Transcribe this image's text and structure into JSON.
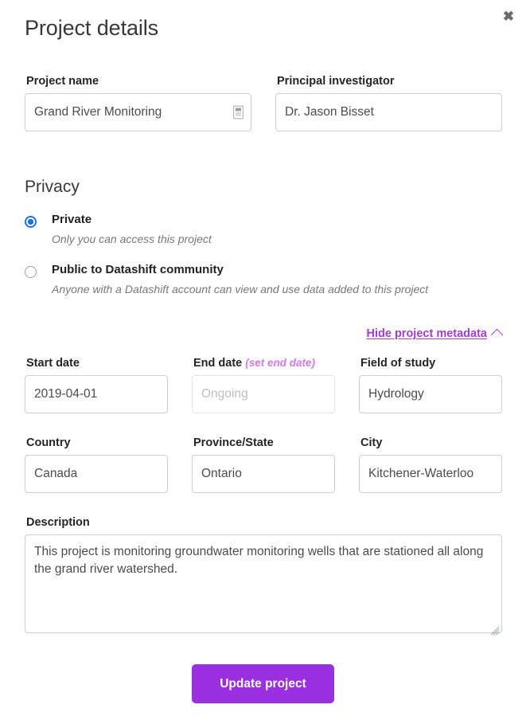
{
  "dialog": {
    "title": "Project details",
    "close_label": "✖"
  },
  "top_fields": {
    "project_name": {
      "label": "Project name",
      "value": "Grand River Monitoring",
      "placeholder": "Project name",
      "icon": "document-icon"
    },
    "principal_investigator": {
      "label": "Principal investigator",
      "value": "Dr. Jason Bisset",
      "placeholder": "Principal investigator"
    }
  },
  "privacy": {
    "heading": "Privacy",
    "options": [
      {
        "title": "Private",
        "description": "Only you can access this project",
        "selected": true
      },
      {
        "title": "Public to Datashift community",
        "description": "Anyone with a Datashift account can view and use data added to this project",
        "selected": false
      }
    ]
  },
  "metadata_toggle": {
    "label": "Hide project metadata",
    "icon": "chevron-up-icon",
    "color": "#a23cd6"
  },
  "metadata": {
    "start_date": {
      "label": "Start date",
      "value": "2019-04-01",
      "placeholder": "Start date"
    },
    "end_date": {
      "label": "End date",
      "note": "(set end date)",
      "value": "",
      "placeholder": "Ongoing"
    },
    "field_of_study": {
      "label": "Field of study",
      "value": "Hydrology",
      "placeholder": "Field of study"
    },
    "country": {
      "label": "Country",
      "value": "Canada",
      "placeholder": "Country"
    },
    "province_state": {
      "label": "Province/State",
      "value": "Ontario",
      "placeholder": "Province/State"
    },
    "city": {
      "label": "City",
      "value": "Kitchener-Waterloo",
      "placeholder": "City"
    }
  },
  "description": {
    "label": "Description",
    "value": "This project is monitoring groundwater monitoring wells that are stationed all along the grand river watershed.",
    "placeholder": "Description"
  },
  "submit": {
    "label": "Update project",
    "color": "#9a2fe0"
  }
}
